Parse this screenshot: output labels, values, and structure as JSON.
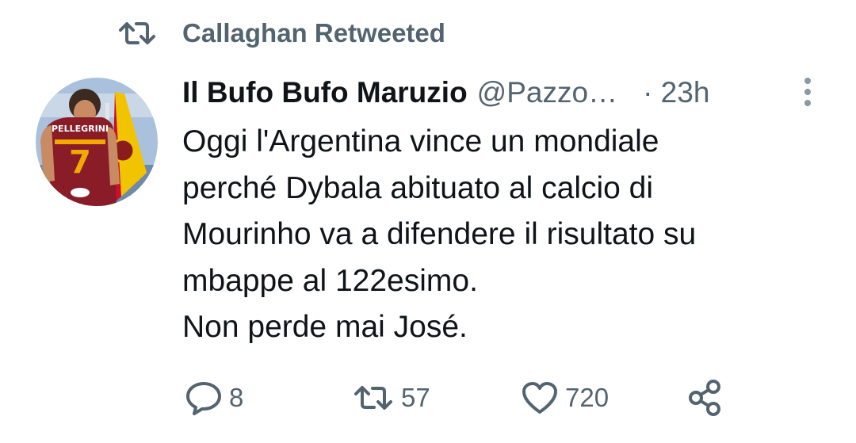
{
  "retweet_context": {
    "icon": "retweet-icon",
    "text": "Callaghan Retweeted"
  },
  "tweet": {
    "avatar": {
      "icon": "avatar",
      "jersey_name": "PELLEGRINI",
      "jersey_number": "7"
    },
    "display_name": "Il Bufo Bufo Maruzio",
    "handle": "@Pazzo…",
    "time": "· 23h",
    "text_lines": [
      "Oggi l'Argentina vince un mondiale",
      "perché Dybala abituato al calcio di",
      "Mourinho va a difendere il risultato su",
      "mbappe al 122esimo.",
      "Non perde mai José."
    ]
  },
  "actions": {
    "reply": {
      "icon": "reply-icon",
      "count": "8"
    },
    "retweet": {
      "icon": "retweet-icon",
      "count": "57"
    },
    "like": {
      "icon": "heart-icon",
      "count": "720"
    },
    "share": {
      "icon": "share-icon"
    }
  },
  "colors": {
    "text_primary": "#0f1419",
    "text_secondary": "#536471",
    "background": "#ffffff"
  }
}
